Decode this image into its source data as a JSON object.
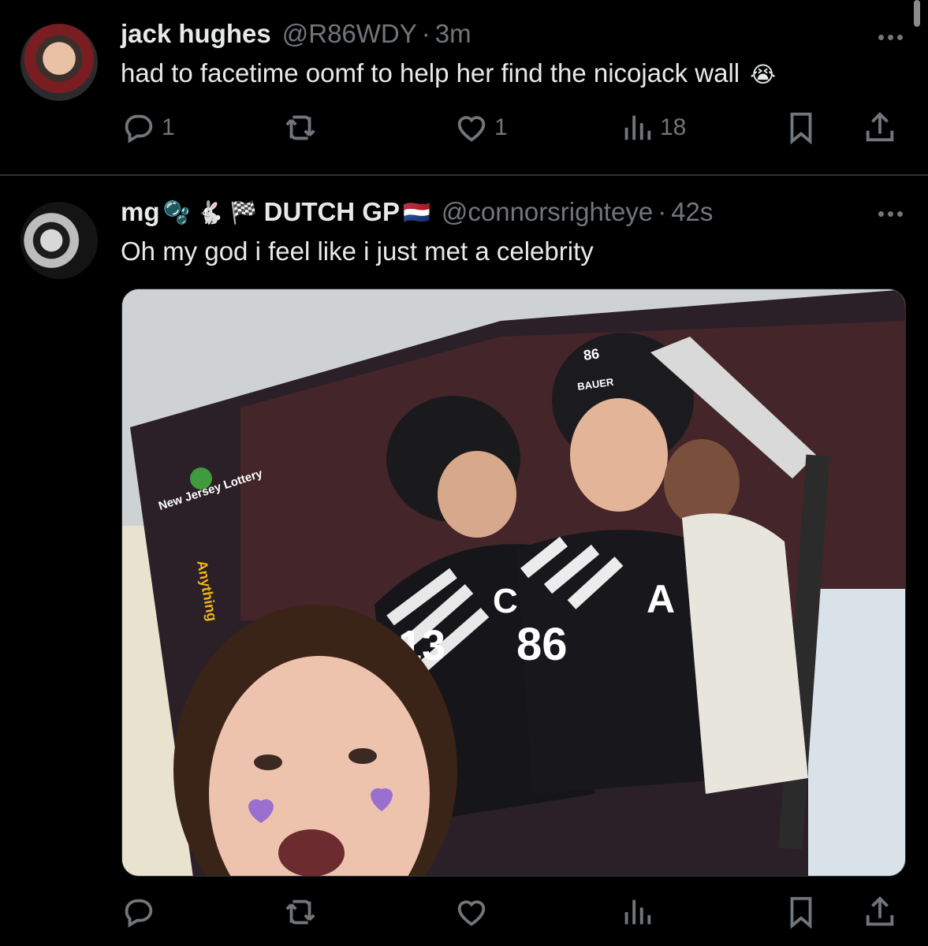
{
  "tweets": [
    {
      "name": "jack hughes",
      "handle": "@R86WDY",
      "separator": "·",
      "time": "3m",
      "text": "had to facetime oomf to help her find the nicojack wall",
      "emoji": "😭",
      "actions": {
        "replies": "1",
        "retweets": "",
        "likes": "1",
        "views": "18"
      }
    },
    {
      "name": "mg",
      "name_decorations": "🫧 🐇 🏁",
      "name_suffix": "DUTCH GP",
      "flag": "🇳🇱",
      "handle": "@connorsrighteye",
      "separator": "·",
      "time": "42s",
      "text": "Oh my god i feel like i just met a celebrity",
      "media_text": [
        "New Jersey Lottery",
        "Anything",
        "13",
        "86",
        "C",
        "A",
        "BAUER",
        "86"
      ],
      "actions": {
        "replies": "",
        "retweets": "",
        "likes": "",
        "views": ""
      }
    }
  ],
  "icons": {
    "reply": "reply-icon",
    "retweet": "retweet-icon",
    "like": "heart-icon",
    "views": "views-icon",
    "bookmark": "bookmark-icon",
    "share": "share-icon",
    "more": "more-icon"
  },
  "colors": {
    "background": "#000000",
    "text": "#e7e9ea",
    "muted": "#71767b",
    "border": "#2f3336"
  }
}
